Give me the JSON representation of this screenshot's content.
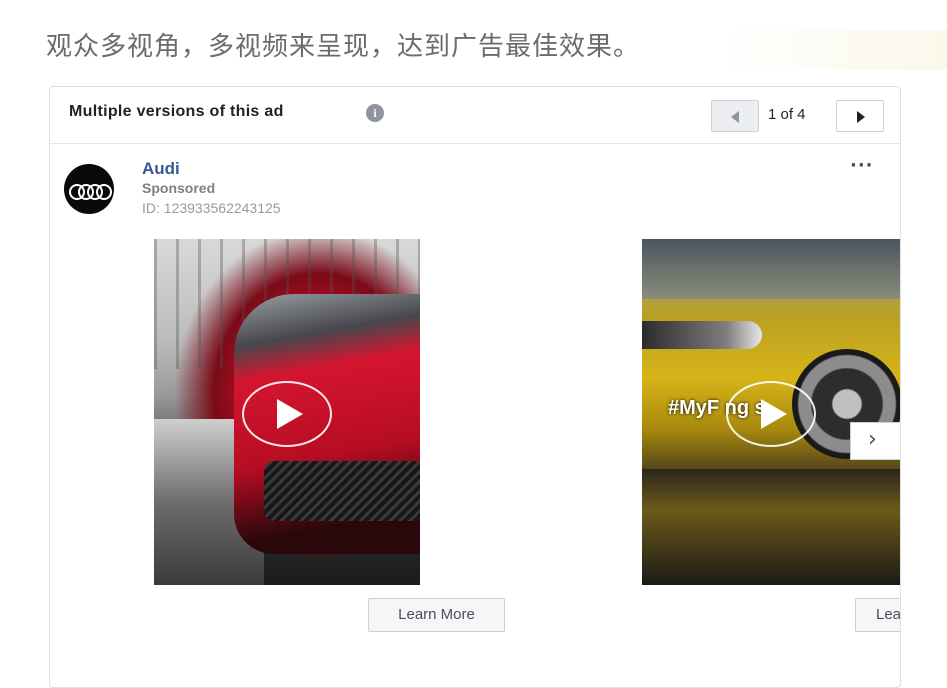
{
  "headline": "观众多视角，多视频来呈现，达到广告最佳效果。",
  "card": {
    "title": "Multiple versions of this ad",
    "info_icon": "info-icon",
    "pager": {
      "label": "1 of 4",
      "prev_icon": "arrow-left-icon",
      "next_icon": "arrow-right-icon"
    }
  },
  "advertiser": {
    "name": "Audi",
    "sponsored": "Sponsored",
    "id": "ID: 123933562243125",
    "avatar_icon": "audi-rings-logo",
    "more_icon": "more-options-icon",
    "more_label": "···"
  },
  "media": [
    {
      "kind": "video",
      "play_icon": "play-icon",
      "cta": "Learn More",
      "overlay": ""
    },
    {
      "kind": "video",
      "play_icon": "play-icon",
      "cta": "Lea",
      "overlay": "#MyF ng s"
    }
  ],
  "carousel": {
    "next_label": "›",
    "next_icon": "chevron-right-icon"
  },
  "colors": {
    "link": "#385898",
    "border": "#dddfe2",
    "headline": "#6b6b6b"
  }
}
